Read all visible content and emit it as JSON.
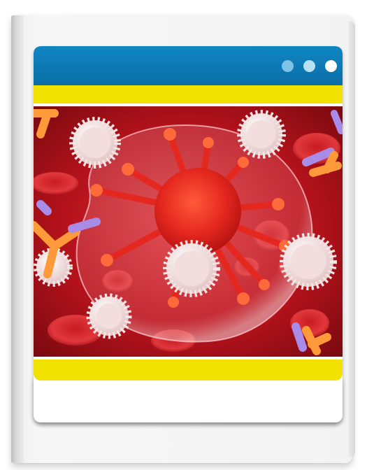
{
  "window": {
    "controls": [
      "dot-icon",
      "dot-icon",
      "dot-icon"
    ]
  },
  "illustration": {
    "subject": "virus-illustration"
  },
  "colors": {
    "titlebar": "#0f86c3",
    "band": "#f2e200",
    "base": "#0a5f92",
    "background": "#b3121b"
  }
}
